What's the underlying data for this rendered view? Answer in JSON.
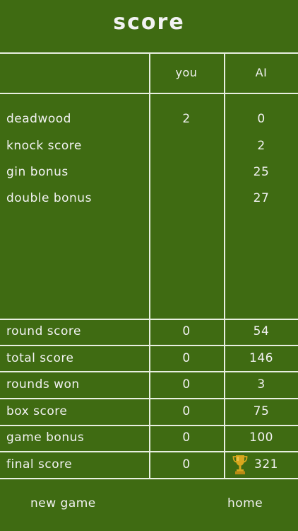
{
  "title": "score",
  "columns": {
    "you": "you",
    "ai": "AI"
  },
  "hand_rows": [
    {
      "label": "deadwood",
      "you": "2",
      "ai": "0"
    },
    {
      "label": "knock score",
      "you": "",
      "ai": "2"
    },
    {
      "label": "gin bonus",
      "you": "",
      "ai": "25"
    },
    {
      "label": "double bonus",
      "you": "",
      "ai": "27"
    }
  ],
  "summary_rows": [
    {
      "label": "round score",
      "you": "0",
      "ai": "54"
    },
    {
      "label": "total score",
      "you": "0",
      "ai": "146"
    },
    {
      "label": "rounds won",
      "you": "0",
      "ai": "3"
    },
    {
      "label": "box score",
      "you": "0",
      "ai": "75"
    },
    {
      "label": "game bonus",
      "you": "0",
      "ai": "100"
    },
    {
      "label": "final score",
      "you": "0",
      "ai": "321"
    }
  ],
  "winner_icon": "trophy-icon",
  "buttons": {
    "new_game": "new game",
    "home": "home"
  },
  "colors": {
    "background": "#3f6b12",
    "lines": "#e8efe0",
    "trophy": "#d8a71d"
  }
}
